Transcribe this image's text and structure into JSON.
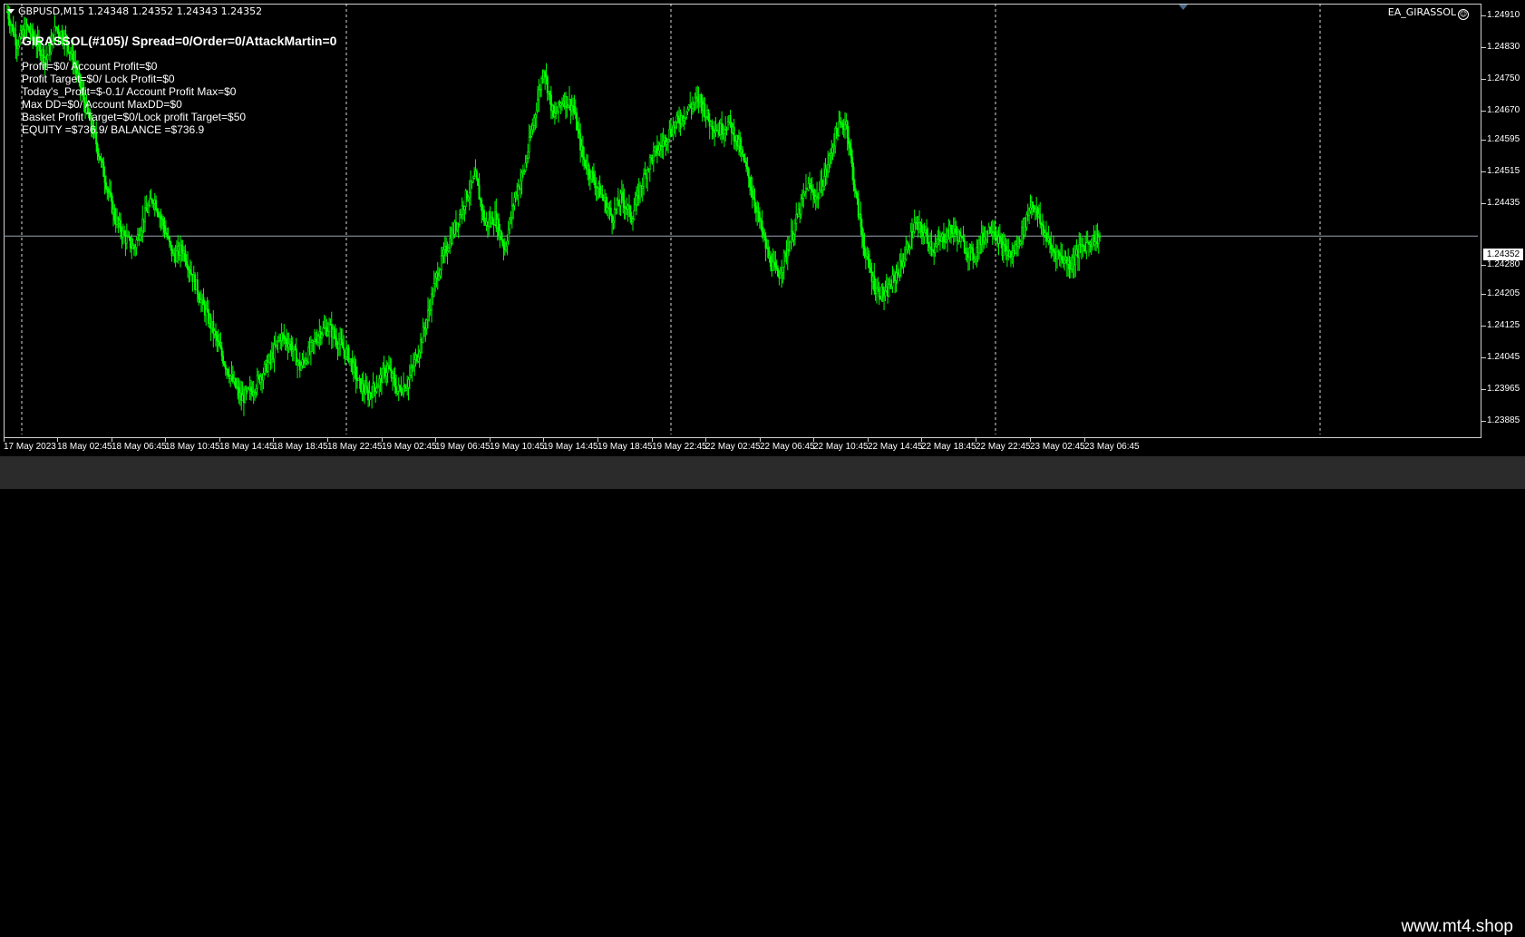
{
  "chart": {
    "symbol_header": "GBPUSD,M15  1.24348 1.24352 1.24343 1.24352",
    "ea_name": "EA_GIRASSOL",
    "ea_status_icon": "smiley-icon",
    "current_price": "1.24352",
    "colors": {
      "background": "#000000",
      "candle": "#00ff00",
      "grid": "#ffffff",
      "bid_line": "#9aa4b0",
      "text": "#ffffff"
    }
  },
  "info_panel": {
    "title": "GIRASSOL(#105)/ Spread=0/Order=0/AttackMartin=0",
    "lines": [
      "Profit=$0/ Account Profit=$0",
      "Profit Target=$0/ Lock Profit=$0",
      "Today's_Profit=$-0.1/ Account Profit Max=$0",
      "Max DD=$0/ Account MaxDD=$0",
      "Basket Profit Target=$0/Lock profit Target=$50",
      "EQUITY =$736.9/ BALANCE =$736.9"
    ]
  },
  "chart_data": {
    "type": "candlestick",
    "title": "GBPUSD,M15",
    "ylim": [
      1.2385,
      1.2494
    ],
    "price_ticks": [
      "1.24910",
      "1.24830",
      "1.24750",
      "1.24670",
      "1.24595",
      "1.24515",
      "1.24435",
      "1.24280",
      "1.24205",
      "1.24125",
      "1.24045",
      "1.23965",
      "1.23885"
    ],
    "time_ticks": [
      "17 May 2023",
      "18 May 02:45",
      "18 May 06:45",
      "18 May 10:45",
      "18 May 14:45",
      "18 May 18:45",
      "18 May 22:45",
      "19 May 02:45",
      "19 May 06:45",
      "19 May 10:45",
      "19 May 14:45",
      "19 May 18:45",
      "19 May 22:45",
      "22 May 02:45",
      "22 May 06:45",
      "22 May 10:45",
      "22 May 14:45",
      "22 May 18:45",
      "22 May 22:45",
      "23 May 02:45",
      "23 May 06:45"
    ],
    "bid": 1.24352,
    "close_path": [
      [
        0,
        1.2492
      ],
      [
        8,
        1.2484
      ],
      [
        16,
        1.2488
      ],
      [
        24,
        1.2484
      ],
      [
        32,
        1.248
      ],
      [
        40,
        1.2488
      ],
      [
        48,
        1.2485
      ],
      [
        56,
        1.2478
      ],
      [
        64,
        1.2468
      ],
      [
        72,
        1.246
      ],
      [
        80,
        1.245
      ],
      [
        88,
        1.244
      ],
      [
        96,
        1.2435
      ],
      [
        104,
        1.2432
      ],
      [
        112,
        1.244
      ],
      [
        120,
        1.2445
      ],
      [
        128,
        1.2438
      ],
      [
        136,
        1.243
      ],
      [
        144,
        1.2432
      ],
      [
        152,
        1.2425
      ],
      [
        160,
        1.2418
      ],
      [
        168,
        1.2412
      ],
      [
        176,
        1.2405
      ],
      [
        184,
        1.2399
      ],
      [
        192,
        1.2394
      ],
      [
        200,
        1.2396
      ],
      [
        208,
        1.24
      ],
      [
        216,
        1.2404
      ],
      [
        224,
        1.241
      ],
      [
        232,
        1.2408
      ],
      [
        240,
        1.2402
      ],
      [
        248,
        1.2406
      ],
      [
        256,
        1.2411
      ],
      [
        264,
        1.2412
      ],
      [
        272,
        1.2408
      ],
      [
        280,
        1.2405
      ],
      [
        288,
        1.2398
      ],
      [
        296,
        1.2395
      ],
      [
        304,
        1.2398
      ],
      [
        312,
        1.2402
      ],
      [
        320,
        1.2396
      ],
      [
        328,
        1.2398
      ],
      [
        336,
        1.2405
      ],
      [
        344,
        1.2414
      ],
      [
        352,
        1.2425
      ],
      [
        360,
        1.2432
      ],
      [
        368,
        1.2438
      ],
      [
        376,
        1.2445
      ],
      [
        384,
        1.245
      ],
      [
        392,
        1.2438
      ],
      [
        400,
        1.244
      ],
      [
        408,
        1.2432
      ],
      [
        416,
        1.2445
      ],
      [
        424,
        1.2452
      ],
      [
        432,
        1.2465
      ],
      [
        440,
        1.2478
      ],
      [
        448,
        1.2465
      ],
      [
        456,
        1.247
      ],
      [
        464,
        1.2468
      ],
      [
        472,
        1.2455
      ],
      [
        480,
        1.245
      ],
      [
        488,
        1.2445
      ],
      [
        496,
        1.244
      ],
      [
        504,
        1.2445
      ],
      [
        512,
        1.244
      ],
      [
        520,
        1.2448
      ],
      [
        528,
        1.2455
      ],
      [
        536,
        1.2458
      ],
      [
        544,
        1.2462
      ],
      [
        552,
        1.2465
      ],
      [
        560,
        1.2468
      ],
      [
        568,
        1.247
      ],
      [
        576,
        1.2464
      ],
      [
        584,
        1.2462
      ],
      [
        592,
        1.2464
      ],
      [
        600,
        1.2458
      ],
      [
        608,
        1.245
      ],
      [
        616,
        1.244
      ],
      [
        624,
        1.243
      ],
      [
        632,
        1.2425
      ],
      [
        640,
        1.2432
      ],
      [
        648,
        1.244
      ],
      [
        656,
        1.2448
      ],
      [
        664,
        1.2445
      ],
      [
        672,
        1.2452
      ],
      [
        680,
        1.2462
      ],
      [
        688,
        1.2464
      ],
      [
        696,
        1.2445
      ],
      [
        704,
        1.243
      ],
      [
        712,
        1.2422
      ],
      [
        720,
        1.242
      ],
      [
        728,
        1.2425
      ],
      [
        736,
        1.243
      ],
      [
        744,
        1.2438
      ],
      [
        752,
        1.2436
      ],
      [
        760,
        1.2432
      ],
      [
        768,
        1.2435
      ],
      [
        776,
        1.2437
      ],
      [
        784,
        1.2433
      ],
      [
        792,
        1.243
      ],
      [
        800,
        1.2435
      ],
      [
        808,
        1.2438
      ],
      [
        816,
        1.2432
      ],
      [
        824,
        1.243
      ],
      [
        832,
        1.2436
      ],
      [
        840,
        1.2444
      ],
      [
        848,
        1.2438
      ],
      [
        856,
        1.2432
      ],
      [
        864,
        1.243
      ],
      [
        872,
        1.2428
      ],
      [
        880,
        1.2432
      ],
      [
        888,
        1.2434
      ],
      [
        896,
        1.2435
      ]
    ]
  },
  "footer": {
    "watermark": "www.mt4.shop"
  }
}
